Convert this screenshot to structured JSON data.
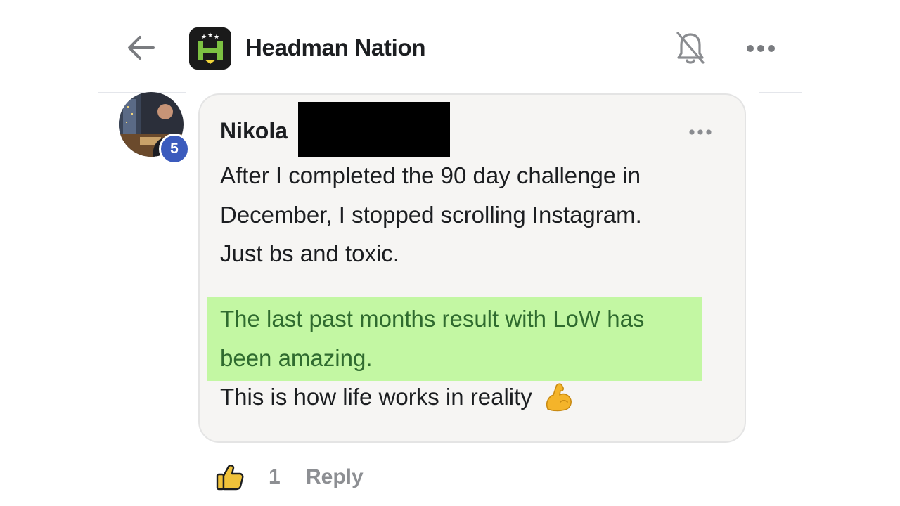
{
  "header": {
    "group_name": "Headman Nation",
    "back_icon": "arrow-left-icon",
    "notifications_icon": "bell-off-icon",
    "more_icon": "more-horizontal-icon"
  },
  "comment": {
    "author_name": "Nikola",
    "author_badge": "5",
    "paragraphs": [
      "After I completed the 90 day challenge in\nDecember, I stopped scrolling Instagram.\nJust bs and toxic.",
      "The last past months result with LoW has\nbeen amazing.",
      "This is how life works in reality"
    ],
    "emoji": "flexed-biceps",
    "highlight_color": "#c3f7a3"
  },
  "actions": {
    "like_icon": "thumbs-up-icon",
    "like_count": "1",
    "reply_label": "Reply"
  }
}
